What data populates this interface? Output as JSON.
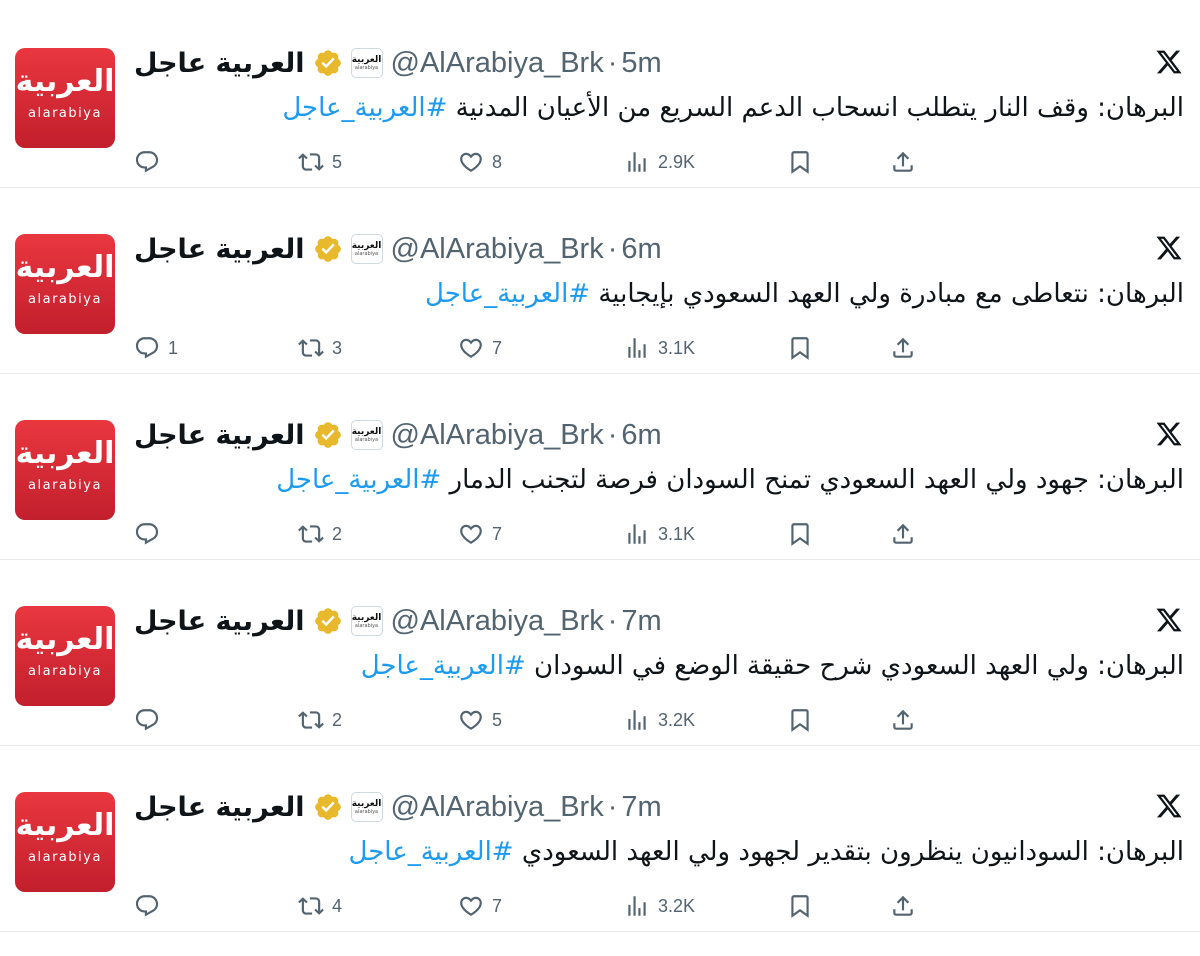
{
  "colors": {
    "accent": "#1d9bf0",
    "secondary_text": "#536471",
    "brand_red": "#d72d37",
    "verified_gold": "#e8b82d"
  },
  "avatar": {
    "logo_arabic": "العربية",
    "logo_latin": "alarabiya"
  },
  "account": {
    "name": "العربية عاجل",
    "handle": "@AlArabiya_Brk",
    "affiliate_badge_ar": "العربية",
    "affiliate_badge_en": "alarabiya"
  },
  "separator": "·",
  "icons": {
    "reply": "reply-icon",
    "retweet": "retweet-icon",
    "like": "heart-icon",
    "views": "views-icon",
    "bookmark": "bookmark-icon",
    "share": "share-icon",
    "verified": "verified-icon",
    "platform": "x-logo-icon"
  },
  "tweets": [
    {
      "time": "5m",
      "text": "البرهان: وقف النار يتطلب انسحاب الدعم السريع من الأعيان المدنية ",
      "hashtag": "#العربية_عاجل",
      "replies": "",
      "retweets": "5",
      "likes": "8",
      "views": "2.9K"
    },
    {
      "time": "6m",
      "text": "البرهان: نتعاطى مع مبادرة ولي العهد السعودي بإيجابية ",
      "hashtag": "#العربية_عاجل",
      "replies": "1",
      "retweets": "3",
      "likes": "7",
      "views": "3.1K"
    },
    {
      "time": "6m",
      "text": "البرهان: جهود ولي العهد السعودي تمنح السودان فرصة لتجنب الدمار ",
      "hashtag": "#العربية_عاجل",
      "replies": "",
      "retweets": "2",
      "likes": "7",
      "views": "3.1K"
    },
    {
      "time": "7m",
      "text": "البرهان: ولي العهد السعودي شرح حقيقة الوضع في السودان ",
      "hashtag": "#العربية_عاجل",
      "replies": "",
      "retweets": "2",
      "likes": "5",
      "views": "3.2K"
    },
    {
      "time": "7m",
      "text": "البرهان: السودانيون ينظرون بتقدير لجهود ولي العهد السعودي ",
      "hashtag": "#العربية_عاجل",
      "replies": "",
      "retweets": "4",
      "likes": "7",
      "views": "3.2K"
    }
  ]
}
